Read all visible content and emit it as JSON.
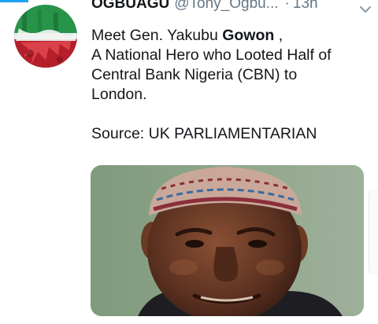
{
  "tweet": {
    "display_name": "OGBUAGU",
    "handle": "@Tony_Ogbu...",
    "separator": "·",
    "timestamp": "13h",
    "caret_icon": "chevron-down-icon",
    "avatar_icon": "nigeria-flag-avatar",
    "text": {
      "line1_prefix": "Meet Gen. Yakubu ",
      "line1_bold": "Gowon",
      "line1_suffix": " ,",
      "line2": "A National Hero who Looted Half of",
      "line3": "Central Bank Nigeria (CBN) to",
      "line4": "London.",
      "source": "Source: UK PARLIAMENTARIAN"
    },
    "media_description_icon": "portrait-photo"
  },
  "colors": {
    "accent": "#1da1f2",
    "text": "#14171a",
    "muted": "#657786",
    "flag_green": "#1f9a4a",
    "flag_red": "#c4242f"
  }
}
